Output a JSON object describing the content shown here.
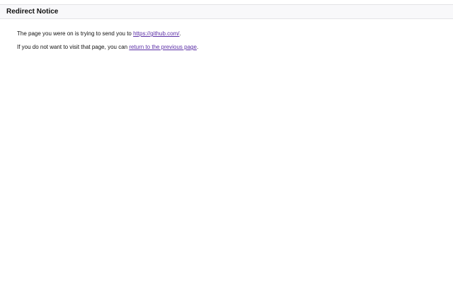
{
  "header": {
    "title": "Redirect Notice"
  },
  "notice": {
    "line1_prefix": "The page you were on is trying to send you to ",
    "redirect_link": "https://github.com/",
    "line1_suffix": ".",
    "line2_prefix": "If you do not want to visit that page, you can ",
    "back_link": "return to the previous page",
    "line2_suffix": "."
  },
  "colors": {
    "header_background": "#f8f8fa",
    "border": "#e3e3e6",
    "link": "#5b2ea6",
    "text": "#111111"
  }
}
